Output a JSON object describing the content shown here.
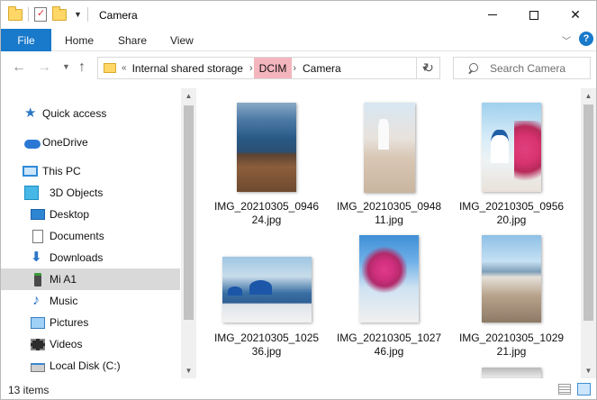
{
  "window": {
    "title": "Camera"
  },
  "ribbon": {
    "file_tab": "File",
    "tabs": [
      "Home",
      "Share",
      "View"
    ]
  },
  "navigation": {
    "address": {
      "overflow_label": "«",
      "crumbs": [
        "Internal shared storage",
        "DCIM",
        "Camera"
      ]
    },
    "search_placeholder": "Search Camera"
  },
  "sidebar": {
    "items": [
      {
        "label": "Quick access",
        "icon": "quick-access-star-icon"
      },
      {
        "label": "OneDrive",
        "icon": "onedrive-cloud-icon"
      },
      {
        "label": "This PC",
        "icon": "this-pc-icon"
      },
      {
        "label": "3D Objects",
        "icon": "3d-objects-icon"
      },
      {
        "label": "Desktop",
        "icon": "desktop-icon"
      },
      {
        "label": "Documents",
        "icon": "documents-icon"
      },
      {
        "label": "Downloads",
        "icon": "downloads-icon"
      },
      {
        "label": "Mi A1",
        "icon": "phone-device-icon",
        "selected": true
      },
      {
        "label": "Music",
        "icon": "music-icon"
      },
      {
        "label": "Pictures",
        "icon": "pictures-icon"
      },
      {
        "label": "Videos",
        "icon": "videos-icon"
      },
      {
        "label": "Local Disk (C:)",
        "icon": "local-disk-icon"
      }
    ]
  },
  "files": [
    {
      "name_line1": "IMG_20210305_0946",
      "name_line2": "24.jpg"
    },
    {
      "name_line1": "IMG_20210305_0948",
      "name_line2": "11.jpg"
    },
    {
      "name_line1": "IMG_20210305_0956",
      "name_line2": "20.jpg"
    },
    {
      "name_line1": "IMG_20210305_1025",
      "name_line2": "36.jpg"
    },
    {
      "name_line1": "IMG_20210305_1027",
      "name_line2": "46.jpg"
    },
    {
      "name_line1": "IMG_20210305_1029",
      "name_line2": "21.jpg"
    }
  ],
  "status": {
    "item_count": "13 items"
  },
  "colors": {
    "file_tab": "#1979ca",
    "dcim_highlight": "#f4b5bd",
    "selected_nav": "#d9d9d9"
  }
}
